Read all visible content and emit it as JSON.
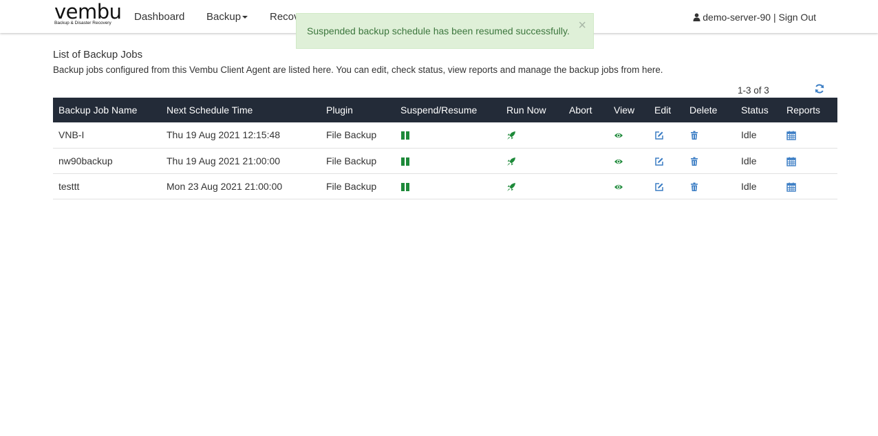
{
  "brand": {
    "name": "vembu",
    "tagline": "Backup & Disaster Recovery"
  },
  "nav": {
    "dashboard": "Dashboard",
    "backup": "Backup",
    "recovery": "Recov"
  },
  "user": {
    "name": "demo-server-90",
    "separator": "|",
    "signout": "Sign Out"
  },
  "alert": {
    "message": "Suspended backup schedule has been resumed successfully.",
    "close": "×"
  },
  "page": {
    "title": "List of Backup Jobs",
    "description": "Backup jobs configured from this Vembu Client Agent are listed here. You can edit, check status, view reports and manage the backup jobs from here.",
    "pager": "1-3 of 3"
  },
  "table": {
    "headers": [
      "Backup Job Name",
      "Next Schedule Time",
      "Plugin",
      "Suspend/Resume",
      "Run Now",
      "Abort",
      "View",
      "Edit",
      "Delete",
      "Status",
      "Reports"
    ],
    "rows": [
      {
        "name": "VNB-I",
        "schedule": "Thu 19 Aug 2021 12:15:48",
        "plugin": "File Backup",
        "abort": "",
        "status": "Idle"
      },
      {
        "name": "nw90backup",
        "schedule": "Thu 19 Aug 2021 21:00:00",
        "plugin": "File Backup",
        "abort": "",
        "status": "Idle"
      },
      {
        "name": "testtt",
        "schedule": "Mon 23 Aug 2021 21:00:00",
        "plugin": "File Backup",
        "abort": "",
        "status": "Idle"
      }
    ]
  },
  "colors": {
    "header_bg": "#232b38",
    "green": "#1e8a3a",
    "blue": "#3b7dc4",
    "alert_bg": "#dff0d8",
    "alert_text": "#3c763d"
  },
  "icons": {
    "suspend": "pause-icon",
    "run": "rocket-icon",
    "view": "eye-icon",
    "edit": "edit-icon",
    "delete": "trash-icon",
    "reports": "calendar-icon",
    "refresh": "refresh-icon",
    "user": "user-icon"
  }
}
